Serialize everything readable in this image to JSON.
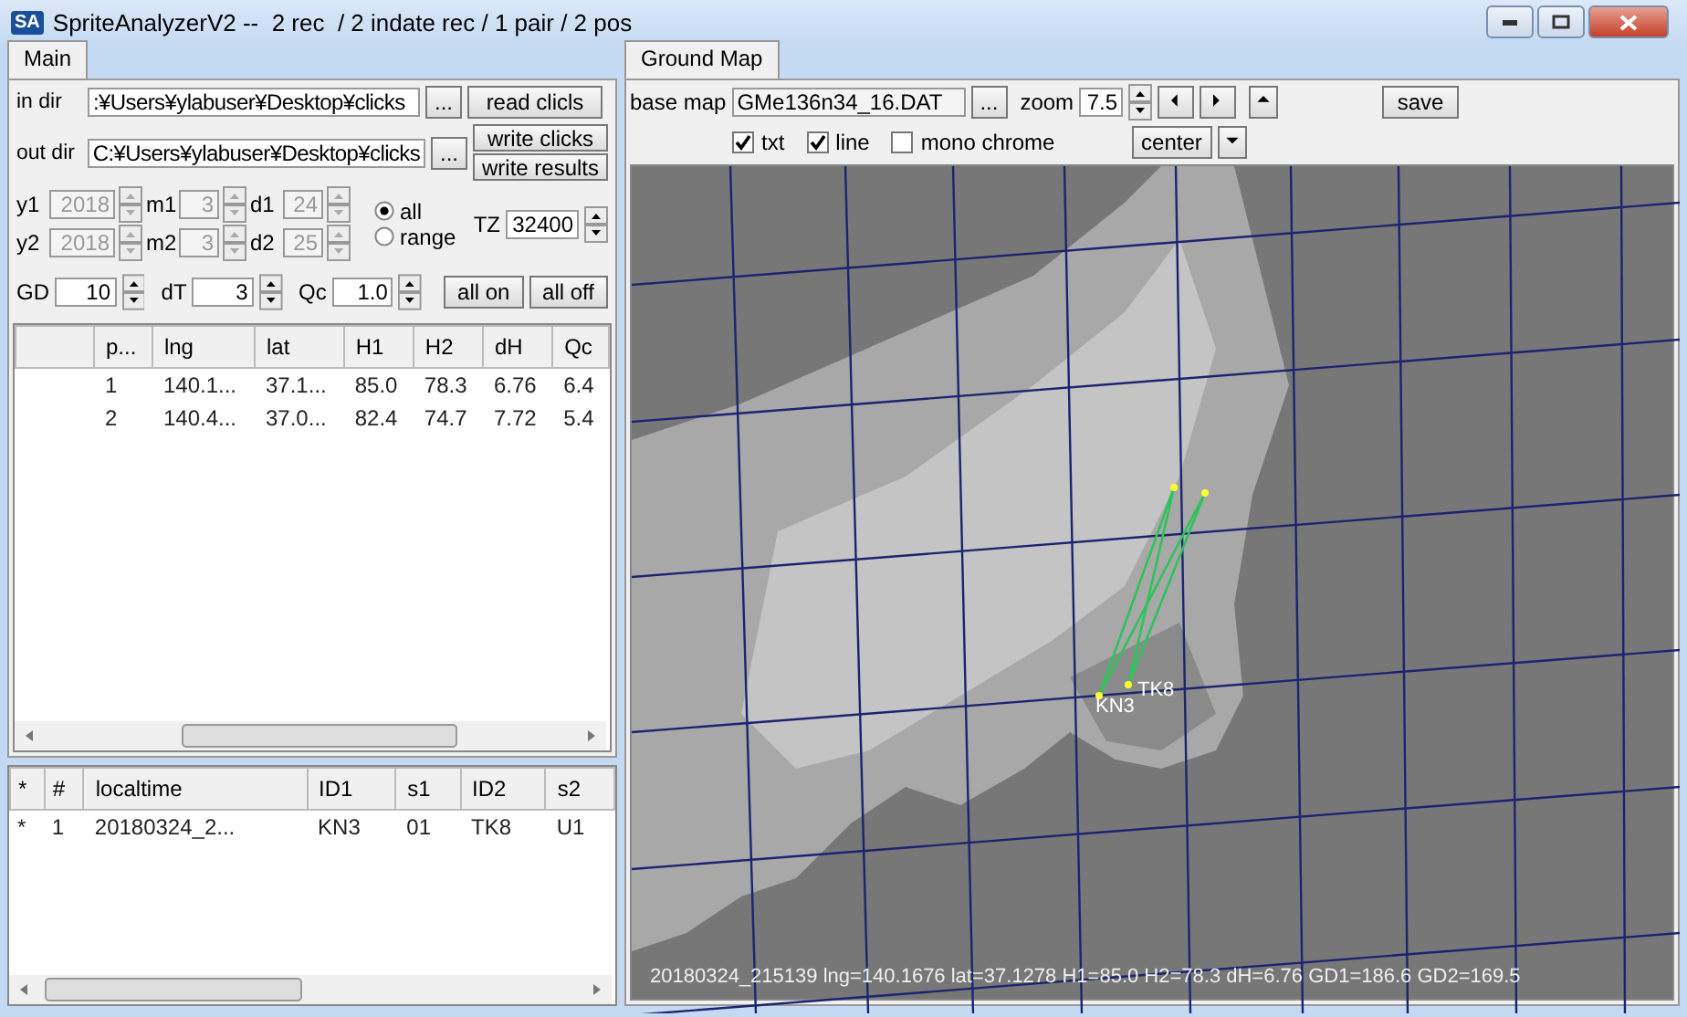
{
  "window": {
    "icon_text": "SA",
    "title": "SpriteAnalyzerV2 --  2 rec  / 2 indate rec / 1 pair / 2 pos"
  },
  "left_tab": {
    "label": "Main",
    "selected": true
  },
  "dirs": [
    {
      "label": "in dir",
      "value": ":¥Users¥ylabuser¥Desktop¥clicks",
      "browse": "...",
      "buttons": [
        "read clicls"
      ]
    },
    {
      "label": "out dir",
      "value": "C:¥Users¥ylabuser¥Desktop¥clicks",
      "browse": "...",
      "buttons": [
        "write clicks",
        "write results"
      ]
    }
  ],
  "dates": [
    [
      {
        "label": "y1",
        "value": "2018",
        "disabled": true
      },
      {
        "label": "m1",
        "value": "3",
        "disabled": true
      },
      {
        "label": "d1",
        "value": "24",
        "disabled": true
      }
    ],
    [
      {
        "label": "y2",
        "value": "2018",
        "disabled": true
      },
      {
        "label": "m2",
        "value": "3",
        "disabled": true
      },
      {
        "label": "d2",
        "value": "25",
        "disabled": true
      }
    ]
  ],
  "range_mode": [
    {
      "label": "all",
      "selected": true
    },
    {
      "label": "range",
      "selected": false
    }
  ],
  "tz": {
    "label": "TZ",
    "value": "32400"
  },
  "params": [
    {
      "label": "GD",
      "value": "10"
    },
    {
      "label": "dT",
      "value": "3"
    },
    {
      "label": "Qc",
      "value": "1.0"
    }
  ],
  "toggle_buttons": [
    "all on",
    "all off"
  ],
  "positions_table": {
    "columns": [
      "p...",
      "lng",
      "lat",
      "H1",
      "H2",
      "dH",
      "Qc"
    ],
    "rows": [
      [
        "1",
        "140.1...",
        "37.1...",
        "85.0",
        "78.3",
        "6.76",
        "6.4"
      ],
      [
        "2",
        "140.4...",
        "37.0...",
        "82.4",
        "74.7",
        "7.72",
        "5.4"
      ]
    ]
  },
  "pairs_table": {
    "columns": [
      "*",
      "#",
      "localtime",
      "ID1",
      "s1",
      "ID2",
      "s2"
    ],
    "rows": [
      [
        "*",
        "1",
        "20180324_2...",
        "KN3",
        "01",
        "TK8",
        "U1"
      ]
    ]
  },
  "right_tab": {
    "label": "Ground Map",
    "selected": true
  },
  "base_map": {
    "label": "base map",
    "value": "GMe136n34_16.DAT",
    "browse": "..."
  },
  "zoom": {
    "label": "zoom",
    "value": "7.5"
  },
  "options": [
    {
      "label": "txt",
      "checked": true
    },
    {
      "label": "line",
      "checked": true
    },
    {
      "label": "mono chrome",
      "checked": false
    }
  ],
  "center_button": "center",
  "save_button": "save",
  "map": {
    "stations": [
      "KN3",
      "TK8"
    ],
    "status": "20180324_215139 lng=140.1676 lat=37.1278 H1=85.0 H2=78.3 dH=6.76 GD1=186.6 GD2=169.5"
  }
}
